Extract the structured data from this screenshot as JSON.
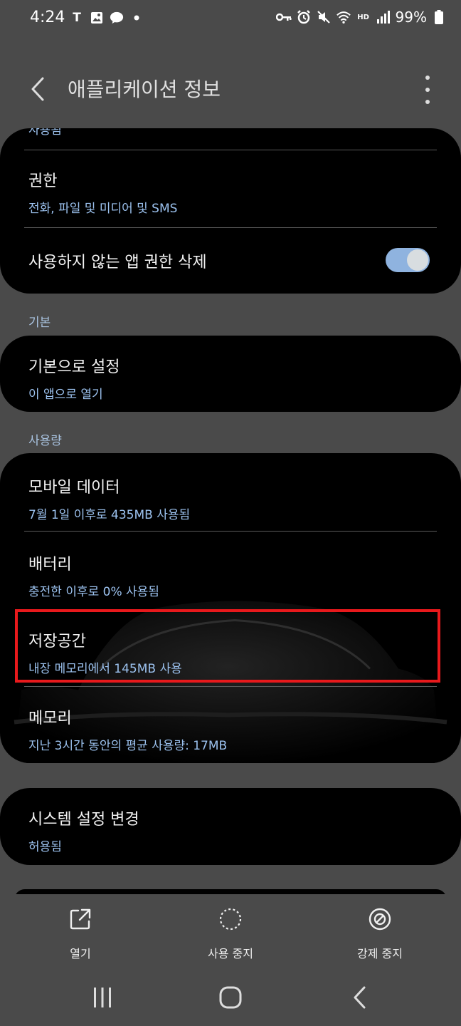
{
  "status_bar": {
    "time": "4:24",
    "left_icons": [
      "t-icon",
      "gallery-icon",
      "talk-icon",
      "dot-icon"
    ],
    "right_icons": [
      "key-icon",
      "alarm-icon",
      "mute-icon",
      "wifi-icon",
      "hd-voice-icon",
      "signal-icon"
    ],
    "hd_label": "HD",
    "battery_percent": "99%"
  },
  "header": {
    "title": "애플리케이션 정보"
  },
  "partial_top_text": "사용됨",
  "permissions_card": {
    "permissions_title": "권한",
    "permissions_sub": "전화, 파일 및 미디어 및 SMS",
    "remove_unused_title": "사용하지 않는 앱 권한 삭제",
    "remove_unused_toggle": "on"
  },
  "section_default": "기본",
  "default_card": {
    "title": "기본으로 설정",
    "sub": "이 앱으로 열기"
  },
  "section_usage": "사용량",
  "usage_card": {
    "mobile_data_title": "모바일 데이터",
    "mobile_data_sub": "7월 1일 이후로 435MB 사용됨",
    "battery_title": "배터리",
    "battery_sub": "충전한 이후로 0% 사용됨",
    "storage_title": "저장공간",
    "storage_sub": "내장 메모리에서 145MB 사용",
    "memory_title": "메모리",
    "memory_sub": "지난 3시간 동안의 평균 사용량: 17MB"
  },
  "system_card": {
    "title": "시스템 설정 변경",
    "sub": "허용됨"
  },
  "actions": {
    "open": "열기",
    "disable": "사용 중지",
    "force_stop": "강제 중지"
  },
  "colors": {
    "background": "#4a4a4a",
    "card": "#000000",
    "subtext": "#9cc2ef",
    "highlight": "#e8191c",
    "toggle_on": "#8fb3df"
  }
}
